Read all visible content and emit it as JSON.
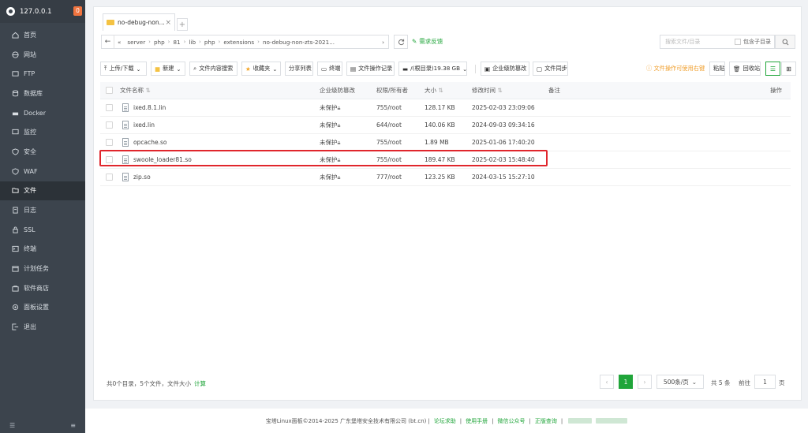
{
  "sidebar": {
    "host": "127.0.0.1",
    "badge": "0",
    "items": [
      {
        "label": "首页",
        "icon": "home-icon"
      },
      {
        "label": "网站",
        "icon": "globe-icon"
      },
      {
        "label": "FTP",
        "icon": "ftp-icon"
      },
      {
        "label": "数据库",
        "icon": "database-icon"
      },
      {
        "label": "Docker",
        "icon": "docker-icon"
      },
      {
        "label": "监控",
        "icon": "monitor-icon"
      },
      {
        "label": "安全",
        "icon": "shield-icon"
      },
      {
        "label": "WAF",
        "icon": "waf-icon"
      },
      {
        "label": "文件",
        "icon": "folder-icon",
        "active": true
      },
      {
        "label": "日志",
        "icon": "log-icon"
      },
      {
        "label": "SSL",
        "icon": "ssl-icon"
      },
      {
        "label": "终端",
        "icon": "terminal-icon"
      },
      {
        "label": "计划任务",
        "icon": "calendar-icon"
      },
      {
        "label": "软件商店",
        "icon": "store-icon"
      },
      {
        "label": "面板设置",
        "icon": "settings-icon"
      },
      {
        "label": "退出",
        "icon": "logout-icon"
      }
    ]
  },
  "tab": {
    "label": "no-debug-non...",
    "close": "×",
    "add": "+"
  },
  "path": {
    "back": "←",
    "collapse": "«",
    "crumbs": [
      "server",
      "php",
      "81",
      "lib",
      "php",
      "extensions",
      "no-debug-non-zts-2021..."
    ],
    "sep": "›",
    "feedback": "需求反馈"
  },
  "search": {
    "placeholder": "搜索文件/目录",
    "include_sub": "包含子目录"
  },
  "toolbar": {
    "upload": "上传/下载",
    "new": "新建",
    "content_search": "文件内容搜索",
    "favorites": "收藏夹",
    "share_list": "分享列表",
    "terminal": "终端",
    "op_log": "文件操作记录",
    "disk": "/(根目录)19.38 GB",
    "tamper": "企业级防篡改",
    "sync": "文件同步",
    "warning": "文件操作可使用右键",
    "paste": "粘贴",
    "recycle": "回收站"
  },
  "table": {
    "headers": {
      "name": "文件名称",
      "tamper": "企业级防篡改",
      "perm": "权限/所有者",
      "size": "大小",
      "mtime": "修改时间",
      "note": "备注",
      "op": "操作"
    },
    "rows": [
      {
        "name": "ixed.8.1.lin",
        "tamper": "未保护",
        "perm": "755/root",
        "size": "128.17 KB",
        "mtime": "2025-02-03 23:09:06"
      },
      {
        "name": "ixed.lin",
        "tamper": "未保护",
        "perm": "644/root",
        "size": "140.06 KB",
        "mtime": "2024-09-03 09:34:16"
      },
      {
        "name": "opcache.so",
        "tamper": "未保护",
        "perm": "755/root",
        "size": "1.89 MB",
        "mtime": "2025-01-06 17:40:20"
      },
      {
        "name": "swoole_loader81.so",
        "tamper": "未保护",
        "perm": "755/root",
        "size": "189.47 KB",
        "mtime": "2025-02-03 15:48:40"
      },
      {
        "name": "zip.so",
        "tamper": "未保护",
        "perm": "777/root",
        "size": "123.25 KB",
        "mtime": "2024-03-15 15:27:10"
      }
    ]
  },
  "bottom": {
    "summary": "共0个目录，5个文件，文件大小",
    "calc": "计算",
    "prev": "‹",
    "page": "1",
    "next": "›",
    "per_page": "500条/页",
    "total": "共 5 条",
    "goto": "前往",
    "goto_value": "1",
    "page_unit": "页"
  },
  "footer": {
    "copyright": "宝塔Linux面板©2014-2025 广东堡塔安全技术有限公司 (bt.cn)",
    "links": [
      "论坛求助",
      "使用手册",
      "微信公众号",
      "正版查询"
    ],
    "sep": "|"
  },
  "colors": {
    "accent": "#20a53a",
    "sidebar": "#3c444d",
    "highlight": "#e0262c",
    "warning": "#f0a030"
  }
}
